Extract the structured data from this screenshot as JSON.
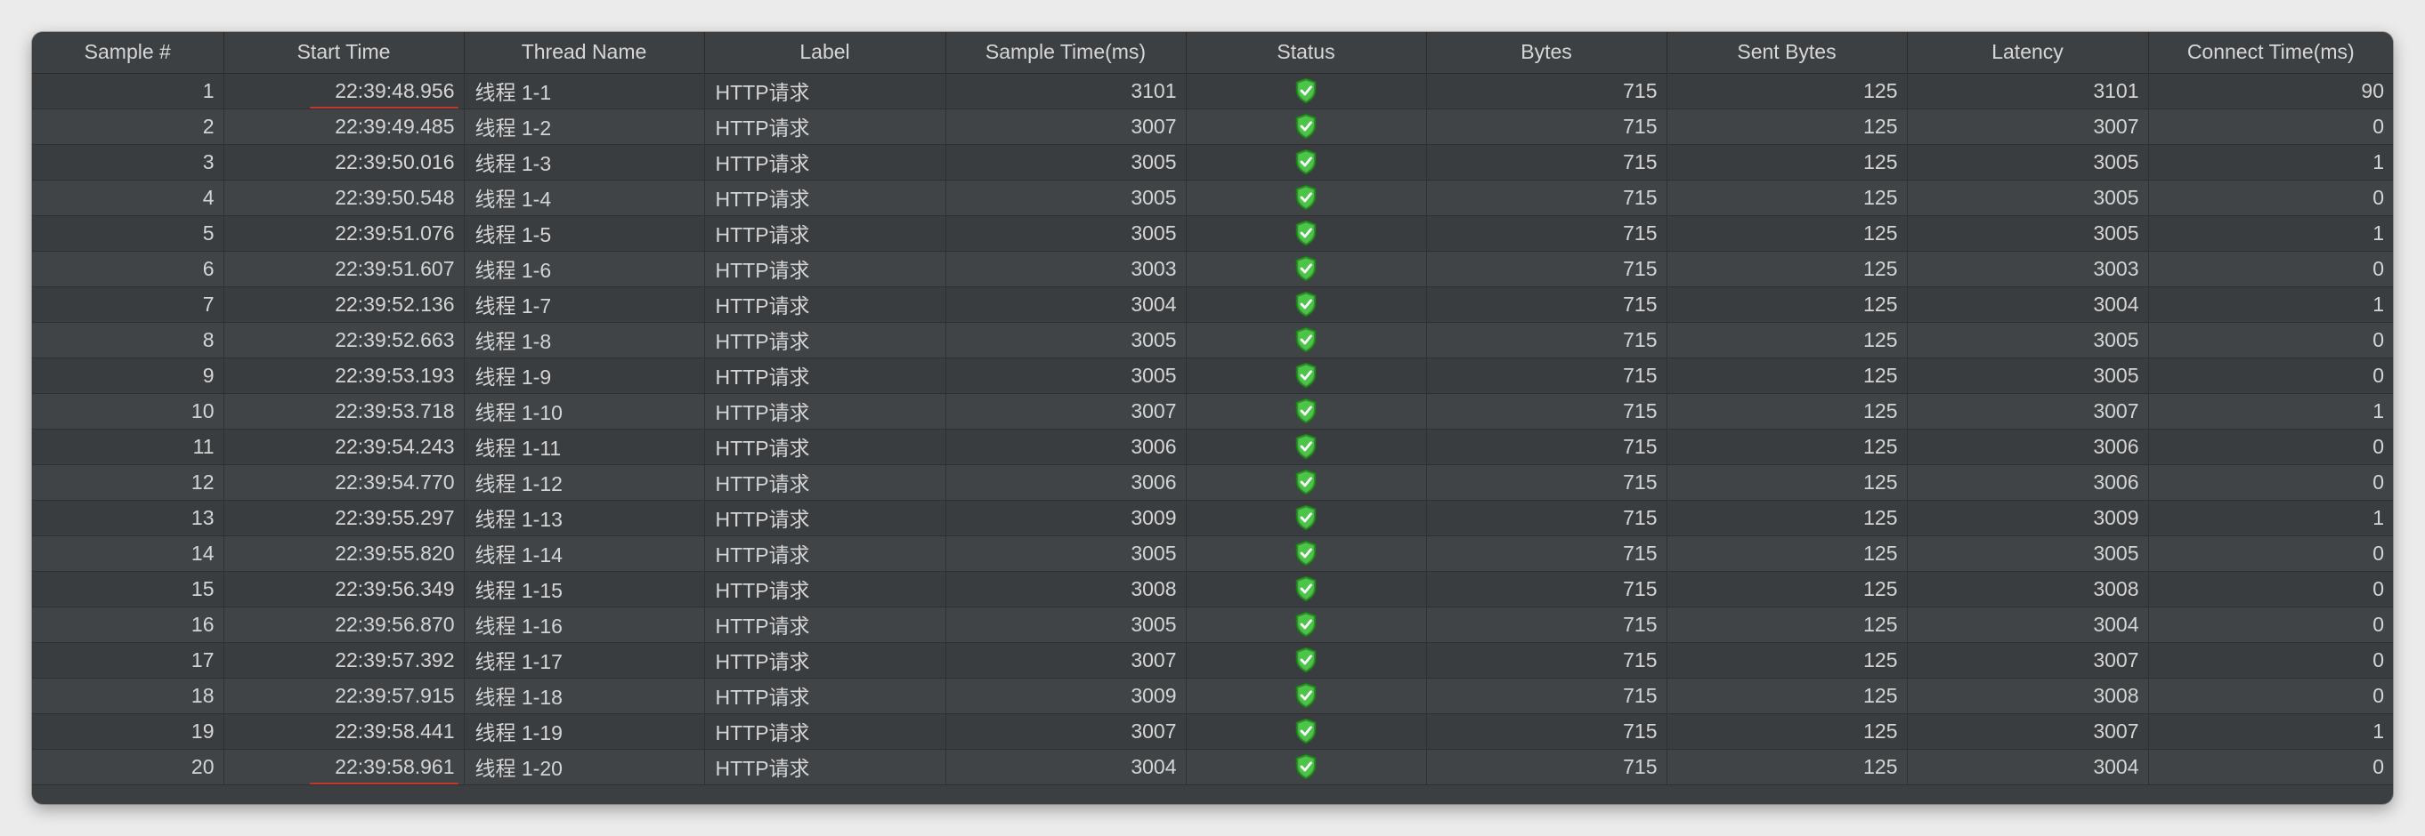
{
  "columns": [
    "Sample #",
    "Start Time",
    "Thread Name",
    "Label",
    "Sample Time(ms)",
    "Status",
    "Bytes",
    "Sent Bytes",
    "Latency",
    "Connect Time(ms)"
  ],
  "colors": {
    "background": "#3c3f41",
    "status_success": "#3ea83a",
    "annotation_underline": "#c0392b"
  },
  "status_icon": "green-shield-check-icon",
  "rows": [
    {
      "sample": "1",
      "start_time": "22:39:48.956",
      "thread": "线程 1-1",
      "label": "HTTP请求",
      "sample_time": "3101",
      "bytes": "715",
      "sent_bytes": "125",
      "latency": "3101",
      "connect_time": "90"
    },
    {
      "sample": "2",
      "start_time": "22:39:49.485",
      "thread": "线程 1-2",
      "label": "HTTP请求",
      "sample_time": "3007",
      "bytes": "715",
      "sent_bytes": "125",
      "latency": "3007",
      "connect_time": "0"
    },
    {
      "sample": "3",
      "start_time": "22:39:50.016",
      "thread": "线程 1-3",
      "label": "HTTP请求",
      "sample_time": "3005",
      "bytes": "715",
      "sent_bytes": "125",
      "latency": "3005",
      "connect_time": "1"
    },
    {
      "sample": "4",
      "start_time": "22:39:50.548",
      "thread": "线程 1-4",
      "label": "HTTP请求",
      "sample_time": "3005",
      "bytes": "715",
      "sent_bytes": "125",
      "latency": "3005",
      "connect_time": "0"
    },
    {
      "sample": "5",
      "start_time": "22:39:51.076",
      "thread": "线程 1-5",
      "label": "HTTP请求",
      "sample_time": "3005",
      "bytes": "715",
      "sent_bytes": "125",
      "latency": "3005",
      "connect_time": "1"
    },
    {
      "sample": "6",
      "start_time": "22:39:51.607",
      "thread": "线程 1-6",
      "label": "HTTP请求",
      "sample_time": "3003",
      "bytes": "715",
      "sent_bytes": "125",
      "latency": "3003",
      "connect_time": "0"
    },
    {
      "sample": "7",
      "start_time": "22:39:52.136",
      "thread": "线程 1-7",
      "label": "HTTP请求",
      "sample_time": "3004",
      "bytes": "715",
      "sent_bytes": "125",
      "latency": "3004",
      "connect_time": "1"
    },
    {
      "sample": "8",
      "start_time": "22:39:52.663",
      "thread": "线程 1-8",
      "label": "HTTP请求",
      "sample_time": "3005",
      "bytes": "715",
      "sent_bytes": "125",
      "latency": "3005",
      "connect_time": "0"
    },
    {
      "sample": "9",
      "start_time": "22:39:53.193",
      "thread": "线程 1-9",
      "label": "HTTP请求",
      "sample_time": "3005",
      "bytes": "715",
      "sent_bytes": "125",
      "latency": "3005",
      "connect_time": "0"
    },
    {
      "sample": "10",
      "start_time": "22:39:53.718",
      "thread": "线程 1-10",
      "label": "HTTP请求",
      "sample_time": "3007",
      "bytes": "715",
      "sent_bytes": "125",
      "latency": "3007",
      "connect_time": "1"
    },
    {
      "sample": "11",
      "start_time": "22:39:54.243",
      "thread": "线程 1-11",
      "label": "HTTP请求",
      "sample_time": "3006",
      "bytes": "715",
      "sent_bytes": "125",
      "latency": "3006",
      "connect_time": "0"
    },
    {
      "sample": "12",
      "start_time": "22:39:54.770",
      "thread": "线程 1-12",
      "label": "HTTP请求",
      "sample_time": "3006",
      "bytes": "715",
      "sent_bytes": "125",
      "latency": "3006",
      "connect_time": "0"
    },
    {
      "sample": "13",
      "start_time": "22:39:55.297",
      "thread": "线程 1-13",
      "label": "HTTP请求",
      "sample_time": "3009",
      "bytes": "715",
      "sent_bytes": "125",
      "latency": "3009",
      "connect_time": "1"
    },
    {
      "sample": "14",
      "start_time": "22:39:55.820",
      "thread": "线程 1-14",
      "label": "HTTP请求",
      "sample_time": "3005",
      "bytes": "715",
      "sent_bytes": "125",
      "latency": "3005",
      "connect_time": "0"
    },
    {
      "sample": "15",
      "start_time": "22:39:56.349",
      "thread": "线程 1-15",
      "label": "HTTP请求",
      "sample_time": "3008",
      "bytes": "715",
      "sent_bytes": "125",
      "latency": "3008",
      "connect_time": "0"
    },
    {
      "sample": "16",
      "start_time": "22:39:56.870",
      "thread": "线程 1-16",
      "label": "HTTP请求",
      "sample_time": "3005",
      "bytes": "715",
      "sent_bytes": "125",
      "latency": "3004",
      "connect_time": "0"
    },
    {
      "sample": "17",
      "start_time": "22:39:57.392",
      "thread": "线程 1-17",
      "label": "HTTP请求",
      "sample_time": "3007",
      "bytes": "715",
      "sent_bytes": "125",
      "latency": "3007",
      "connect_time": "0"
    },
    {
      "sample": "18",
      "start_time": "22:39:57.915",
      "thread": "线程 1-18",
      "label": "HTTP请求",
      "sample_time": "3009",
      "bytes": "715",
      "sent_bytes": "125",
      "latency": "3008",
      "connect_time": "0"
    },
    {
      "sample": "19",
      "start_time": "22:39:58.441",
      "thread": "线程 1-19",
      "label": "HTTP请求",
      "sample_time": "3007",
      "bytes": "715",
      "sent_bytes": "125",
      "latency": "3007",
      "connect_time": "1"
    },
    {
      "sample": "20",
      "start_time": "22:39:58.961",
      "thread": "线程 1-20",
      "label": "HTTP请求",
      "sample_time": "3004",
      "bytes": "715",
      "sent_bytes": "125",
      "latency": "3004",
      "connect_time": "0"
    }
  ],
  "annotations": {
    "underlined_rows": [
      1,
      20
    ],
    "underline_column": "Start Time"
  }
}
